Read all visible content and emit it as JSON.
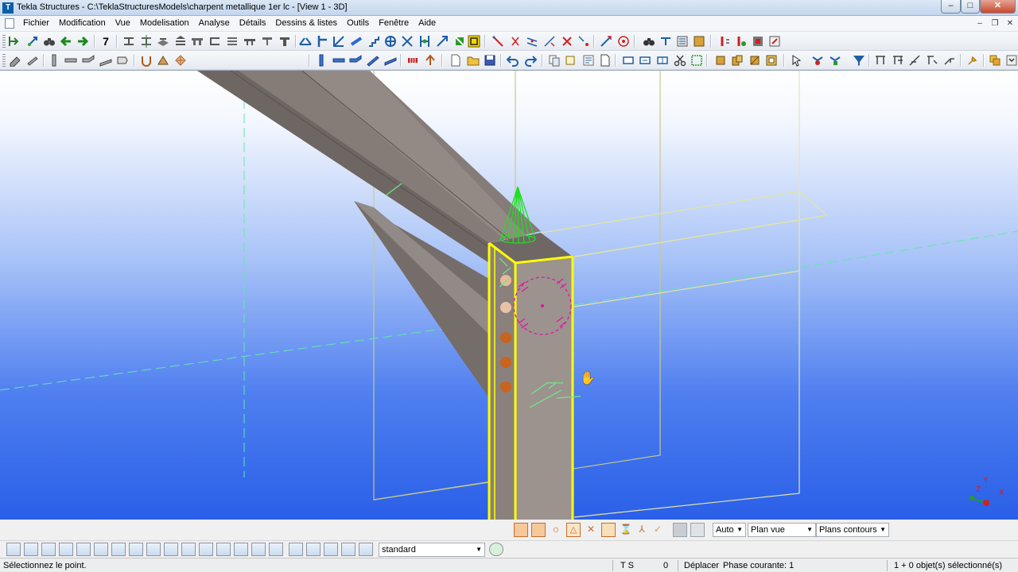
{
  "window": {
    "title": "Tekla Structures - C:\\TeklaStructuresModels\\charpent metallique 1er lc - [View 1 - 3D]",
    "app_icon_letter": "T",
    "minimize_label": "–",
    "maximize_label": "□",
    "close_label": "✕"
  },
  "menu": {
    "items": [
      "Fichier",
      "Modification",
      "Vue",
      "Modelisation",
      "Analyse",
      "Détails",
      "Dessins & listes",
      "Outils",
      "Fenêtre",
      "Aide"
    ],
    "mdi_minimize": "–",
    "mdi_restore": "❐",
    "mdi_close": "✕"
  },
  "toolbar1": {
    "number_button_label": "7"
  },
  "viewport": {
    "view_name": "View 1 - 3D",
    "axis_labels": {
      "x": "X",
      "y": "Y",
      "z": "Z"
    },
    "cursor_icon": "hand-cursor-icon"
  },
  "select_bar": {
    "auto_dropdown": "Auto",
    "view_plane_dropdown": "Plan vue",
    "contours_dropdown": "Plans contours"
  },
  "snap_bar": {
    "snap_setting_dropdown": "standard"
  },
  "status_bar": {
    "prompt": "Sélectionnez le point.",
    "ts_label": "T S",
    "count": "0",
    "mode": "Déplacer",
    "phase": "Phase courante: 1",
    "selection": "1 + 0 objet(s) sélectionné(s)"
  },
  "colors": {
    "viewport_top": "#ffffff",
    "viewport_bottom": "#2a5fe8",
    "beam_fill": "#847c78",
    "selected_outline": "#ffff00",
    "work_area": "#d9d98a",
    "snap_green": "#22dd22",
    "bolt_orange": "#c8641e",
    "weld_symbol": "#dd1aa0"
  }
}
